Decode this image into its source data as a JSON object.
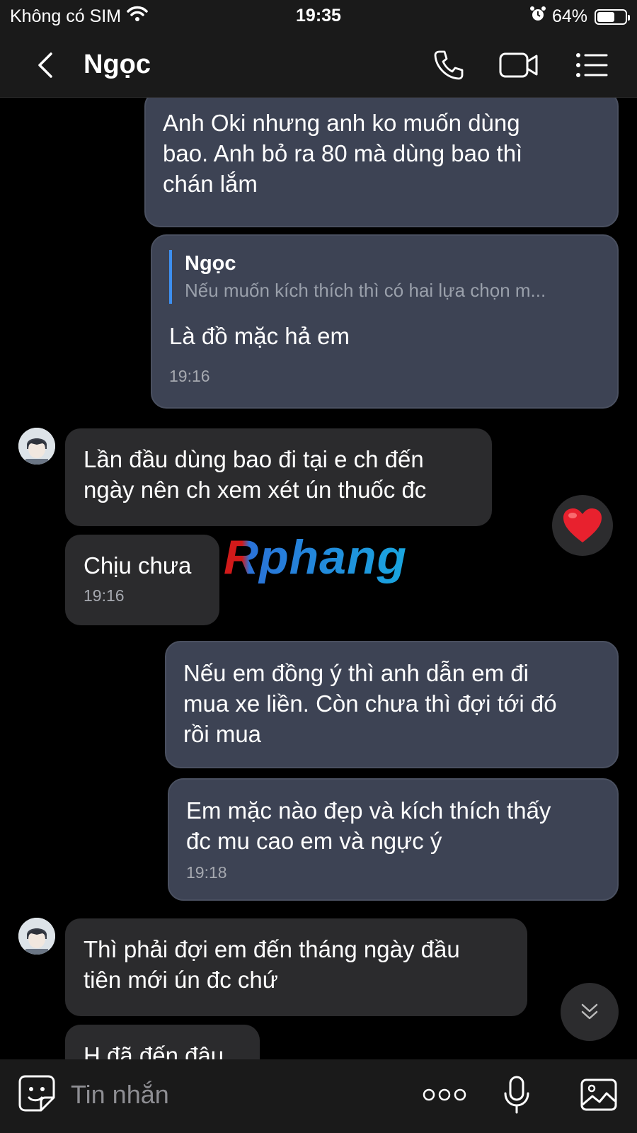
{
  "status_bar": {
    "carrier": "Không có SIM",
    "time": "19:35",
    "battery": "64%",
    "battery_level": 0.64
  },
  "header": {
    "contact_name": "Ngọc"
  },
  "messages": [
    {
      "text": "Anh Oki nhưng anh ko muốn dùng\nbao. Anh bỏ ra 80 mà dùng bao thì\nchán lắm"
    },
    {
      "reply_to": {
        "name": "Ngọc",
        "text": "Nếu muốn kích thích thì có hai lựa chọn m..."
      },
      "text": "Là đồ mặc hả em",
      "time": "19:16"
    },
    {
      "text": "Lần đầu dùng bao đi tại e ch đến\nngày nên ch xem xét ún thuốc đc"
    },
    {
      "text": "Chịu chưa",
      "time": "19:16"
    },
    {
      "text": "Nếu em đồng ý thì anh dẫn em đi\nmua xe liền. Còn chưa thì đợi tới đó\nrồi mua"
    },
    {
      "text": "Em mặc nào đẹp và kích thích thấy\nđc mu cao em và ngực ý",
      "time": "19:18"
    },
    {
      "text": "Thì phải đợi em đến tháng ngày đầu\ntiên mới ún đc chứ"
    },
    {
      "text": "H đã đến đâu"
    }
  ],
  "reaction": "heart-emoji",
  "watermark": "Rphang",
  "composer": {
    "placeholder": "Tin nhắn"
  }
}
